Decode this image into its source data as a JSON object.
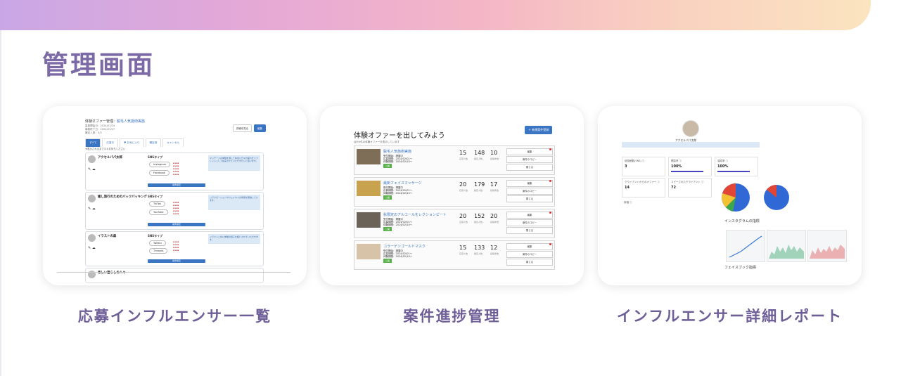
{
  "page": {
    "title": "管理画面"
  },
  "cards": [
    {
      "caption": "応募インフルエンサー一覧"
    },
    {
      "caption": "案件進捗管理"
    },
    {
      "caption": "インフルエンサー詳細レポート"
    }
  ],
  "applicants": {
    "heading": "体験オファー管理：",
    "heading_link": "脱毛人気施術実施",
    "meta": [
      "募集開始日：2024/01/24",
      "募集終了日：2024/01/27",
      "確定人数：0/5"
    ],
    "button_sub": "詳細を見る",
    "button_main": "編集",
    "tabs": [
      "すべて",
      "応募中",
      "♥ お気に入り",
      "確定済",
      "キャンセル"
    ],
    "note": "★表示されるまで少々お待ちください",
    "rows": [
      {
        "name": "アクセルパパ太郎",
        "sns_label": "SNSタイプ",
        "sns": [
          "Instagram",
          "Facebook"
        ],
        "message": "マッサージの体験を通して本当に日々の疲れをリフレッシュして充実させていただきたいと思います。",
        "action": "案件確定"
      },
      {
        "name": "癒し旅行のためのバックパッキング",
        "sns_label": "SNSタイプ",
        "sns": [
          "TikTok",
          "YouTube"
        ],
        "message": "リラクゼーションやウェルネスの情報を発信しています。",
        "action": "案件確定"
      },
      {
        "name": "イラストの森",
        "sns_label": "SNSタイプ",
        "sns": [
          "Twitter",
          "Threads"
        ],
        "message": "イラストと共に体験の様子を紹介させていただきます。",
        "action": "案件確定"
      },
      {
        "name": "楽しい暮らしの人々"
      }
    ]
  },
  "progress": {
    "title": "体験オファーを出してみよう",
    "add_button": "＋ 新規案件登録",
    "subtitle": "合計4件の体験オファーを表示しています",
    "stat_labels": [
      "応募人数",
      "確定人数",
      "投稿件数"
    ],
    "actions": [
      "編集",
      "案件のコピー",
      "閉じる"
    ],
    "rows": [
      {
        "name": "脱毛人気施術実施",
        "detail": [
          "受付開始：掲載中",
          "応募期間：2024/02/01〜",
          "体験期間：2024/02/10〜"
        ],
        "tag": "公開",
        "nums": [
          "15",
          "148",
          "10"
        ]
      },
      {
        "name": "最新フェイスマッサージ",
        "detail": [
          "受付開始：掲載中",
          "応募期間：2024/02/01〜",
          "体験期間：2024/02/10〜"
        ],
        "tag": "公開",
        "nums": [
          "20",
          "179",
          "17"
        ]
      },
      {
        "name": "秋限定のアルコールをレクションピート",
        "detail": [
          "受付開始：掲載中",
          "応募期間：2024/02/01〜",
          "体験期間：2024/02/10〜"
        ],
        "tag": "公開",
        "nums": [
          "20",
          "152",
          "20"
        ]
      },
      {
        "name": "コラーゲンゴールドマスク",
        "detail": [
          "受付開始：掲載中",
          "応募期間：2024/02/01〜",
          "体験期間：2024/02/10〜"
        ],
        "tag": "公開",
        "nums": [
          "15",
          "133",
          "12"
        ]
      }
    ]
  },
  "report": {
    "name": "アクセルパパ太郎",
    "stats": [
      {
        "label": "総投稿数(SNS) ⓘ",
        "value": "3"
      },
      {
        "label": "閲覧率 ⓘ",
        "value": "100%"
      },
      {
        "label": "達成率 ⓘ",
        "value": "100%"
      },
      {
        "label": "クライアントからのオファー ⓘ",
        "value": "14"
      },
      {
        "label": "コピーされたクライアント ⓘ",
        "value": "72"
      },
      {
        "label": "評価 ⓘ",
        "value": ""
      }
    ],
    "instagram_heading": "インスタグラムの指標",
    "facebook_heading": "フェイスブック指標",
    "colors": {
      "pie_blue": "#3069d6",
      "pie_red": "#e04535",
      "pie_yellow": "#f2c230",
      "pie_green": "#3ca84a",
      "line_blue": "#3a7bd5",
      "line_green": "#4bb07a",
      "line_red": "#e05a5a"
    }
  }
}
